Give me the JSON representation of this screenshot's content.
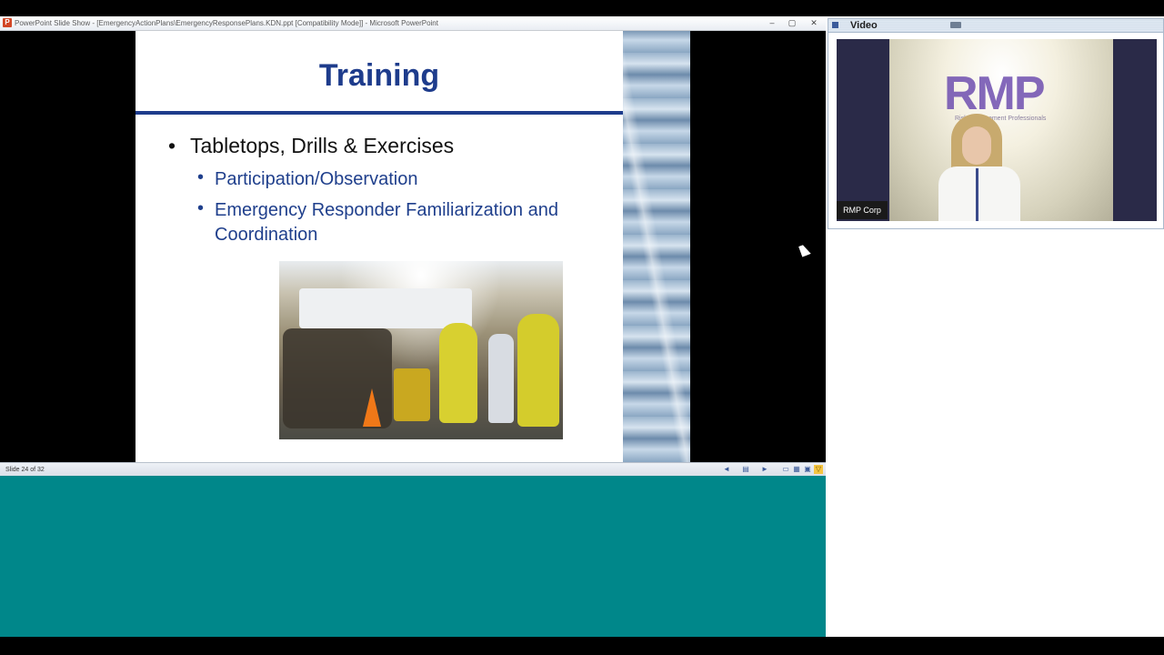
{
  "powerpoint": {
    "window_title": "PowerPoint Slide Show - [EmergencyActionPlans\\EmergencyResponsePlans.KDN.ppt [Compatibility Mode]] - Microsoft PowerPoint",
    "app_icon_letter": "P",
    "window_buttons": [
      "–",
      "▢",
      "✕"
    ],
    "status": "Slide 24 of 32"
  },
  "slide": {
    "title": "Training",
    "bullet": "Tabletops, Drills & Exercises",
    "sub_bullets": [
      "Participation/Observation",
      "Emergency Responder Familiarization and Coordination"
    ],
    "bullet_char": "•"
  },
  "video_pod": {
    "title": "Video",
    "presenter_label": "RMP Corp",
    "logo_text": "RMP",
    "logo_tagline": "Risk Management Professionals"
  },
  "colors": {
    "slide_title": "#1e3c8c",
    "sub_bullet": "#1f3f8c",
    "teal_background": "#00878a"
  },
  "icons": {
    "status_prev": "◄",
    "status_next": "►",
    "status_notes": "▤",
    "view_normal": "▭",
    "view_sorter": "▦",
    "view_reading": "▣",
    "view_slideshow": "▽"
  }
}
